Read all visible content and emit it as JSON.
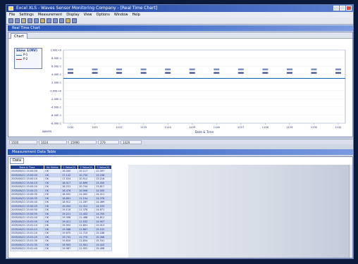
{
  "window": {
    "title": "Excel XLS - Waves Sensor Monitoring Company - [Real Time Chart]"
  },
  "menu": [
    "File",
    "Settings",
    "Measurement",
    "Display",
    "View",
    "Options",
    "Window",
    "Help"
  ],
  "chart_window": {
    "title": "Real Time Chart",
    "tab": "Chart",
    "legend_title": "Skew 1(MV)",
    "legend_items": [
      "P-1",
      "P-2"
    ]
  },
  "chart_data": {
    "type": "line",
    "ylabel": "",
    "xlabel": "Date & Time",
    "y_ticks": [
      "1.00E+0",
      "8.00E-1",
      "6.00E-1",
      "4.00E-1",
      "2.00E-1",
      "0.00E+0",
      "-2.00E-1",
      "-4.00E-1",
      "-6.00E-1",
      "-8.00E-1"
    ],
    "x_ticks": [
      "1120",
      "1121",
      "1122",
      "1123",
      "1124",
      "1125",
      "1126",
      "1127",
      "1128",
      "1129",
      "1130",
      "1131"
    ],
    "series": [
      {
        "name": "P-1",
        "values": [
          0.3,
          0.3,
          0.3,
          0.3,
          0.3,
          0.3,
          0.3,
          0.3,
          0.3,
          0.3,
          0.3,
          0.3,
          0.3
        ]
      }
    ],
    "footer_label": "WAVES"
  },
  "status": [
    "1500",
    "1024",
    "15990",
    "279",
    "1429"
  ],
  "table_window": {
    "title": "Measurement Data Table",
    "tab": "Data",
    "columns": [
      "Date & Time",
      "Kb Status",
      "1 Value(V)",
      "2 Value(V)",
      "3 Value(V)"
    ],
    "rows": [
      [
        "2005/06/21 15:00:00",
        "OK",
        "16.000",
        "10.117",
        "12.097"
      ],
      [
        "2005/06/21 15:00:05",
        "OK",
        "17.142",
        "10.734",
        "13.106"
      ],
      [
        "2005/06/21 15:00:10",
        "OK",
        "17.524",
        "10.512",
        "13.218"
      ],
      [
        "2005/06/21 15:00:15",
        "OK",
        "18.017",
        "10.899",
        "13.450"
      ],
      [
        "2005/06/21 15:00:20",
        "OK",
        "18.231",
        "10.744",
        "13.817"
      ],
      [
        "2005/06/21 15:00:25",
        "OK",
        "18.476",
        "10.906",
        "14.005"
      ],
      [
        "2005/06/21 15:00:30",
        "OK",
        "18.552",
        "11.002",
        "14.211"
      ],
      [
        "2005/06/21 15:00:35",
        "OK",
        "18.801",
        "11.154",
        "14.378"
      ],
      [
        "2005/06/21 15:00:40",
        "OK",
        "18.912",
        "11.287",
        "14.469"
      ],
      [
        "2005/06/21 15:00:45",
        "OK",
        "19.004",
        "11.312",
        "14.533"
      ],
      [
        "2005/06/21 15:00:50",
        "OK",
        "19.118",
        "11.376",
        "14.671"
      ],
      [
        "2005/06/21 15:00:55",
        "OK",
        "19.221",
        "11.402",
        "14.705"
      ],
      [
        "2005/06/21 15:01:00",
        "OK",
        "19.306",
        "11.488",
        "14.812"
      ],
      [
        "2005/06/21 15:01:05",
        "OK",
        "19.411",
        "11.532",
        "14.907"
      ],
      [
        "2005/06/21 15:01:10",
        "OK",
        "19.502",
        "11.601",
        "15.013"
      ],
      [
        "2005/06/21 15:01:15",
        "OK",
        "19.588",
        "11.667",
        "15.102"
      ],
      [
        "2005/06/21 15:01:20",
        "OK",
        "19.675",
        "11.719",
        "15.188"
      ],
      [
        "2005/06/21 15:01:25",
        "OK",
        "19.741",
        "11.770",
        "15.266"
      ],
      [
        "2005/06/21 15:01:30",
        "OK",
        "19.820",
        "11.834",
        "15.341"
      ],
      [
        "2005/06/21 15:01:35",
        "OK",
        "19.903",
        "11.901",
        "15.420"
      ],
      [
        "2005/06/21 15:01:40",
        "OK",
        "19.987",
        "11.952",
        "15.498"
      ]
    ]
  },
  "colors": {
    "titlebar": "#1a3f9e",
    "series": "#1f67b3",
    "grid_header": "#1f3e8f"
  }
}
